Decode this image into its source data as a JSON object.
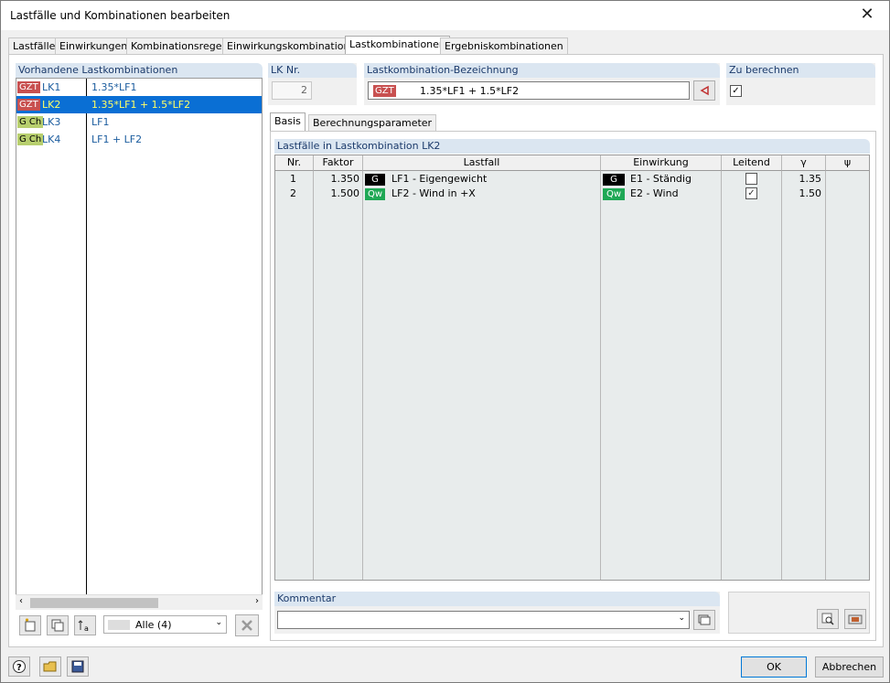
{
  "window": {
    "title": "Lastfälle und Kombinationen bearbeiten",
    "close": "✕"
  },
  "tabs": [
    "Lastfälle",
    "Einwirkungen",
    "Kombinationsregeln",
    "Einwirkungskombinationen",
    "Lastkombinationen",
    "Ergebniskombinationen"
  ],
  "left": {
    "title": "Vorhandene Lastkombinationen",
    "rows": [
      {
        "badge": "GZT",
        "name": "LK1",
        "formula": "1.35*LF1",
        "badge_color": "#c85050"
      },
      {
        "badge": "GZT",
        "name": "LK2",
        "formula": "1.35*LF1 + 1.5*LF2",
        "badge_color": "#c85050"
      },
      {
        "badge": "G Ch",
        "name": "LK3",
        "formula": "LF1",
        "badge_color": "#b8cf6e"
      },
      {
        "badge": "G Ch",
        "name": "LK4",
        "formula": "LF1 + LF2",
        "badge_color": "#b8cf6e"
      }
    ],
    "filter": "Alle (4)"
  },
  "lknr": {
    "label": "LK Nr.",
    "value": "2"
  },
  "bezeichnung": {
    "label": "Lastkombination-Bezeichnung",
    "badge": "GZT",
    "value": "1.35*LF1 + 1.5*LF2"
  },
  "zuberechnen": {
    "label": "Zu berechnen",
    "checked": "✓"
  },
  "subtabs": [
    "Basis",
    "Berechnungsparameter"
  ],
  "table": {
    "title": "Lastfälle in Lastkombination LK2",
    "headers": [
      "Nr.",
      "Faktor",
      "Lastfall",
      "Einwirkung",
      "Leitend",
      "γ",
      "ψ"
    ],
    "rows": [
      {
        "nr": "1",
        "faktor": "1.350",
        "lf_badge": "G",
        "lastfall": "LF1 - Eigengewicht",
        "ew_badge": "G",
        "einwirkung": "E1 - Ständig",
        "leitend": "",
        "gamma": "1.35"
      },
      {
        "nr": "2",
        "faktor": "1.500",
        "lf_badge": "Qw",
        "lastfall": "LF2 - Wind in +X",
        "ew_badge": "Qw",
        "einwirkung": "E2 - Wind",
        "leitend": "✓",
        "gamma": "1.50"
      }
    ]
  },
  "kommentar": {
    "label": "Kommentar",
    "value": ""
  },
  "buttons": {
    "ok": "OK",
    "cancel": "Abbrechen"
  }
}
